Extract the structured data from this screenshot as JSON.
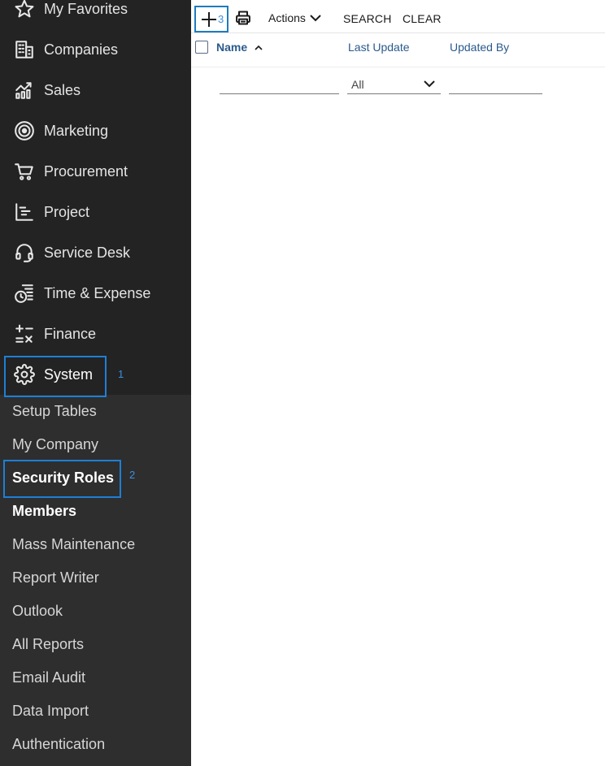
{
  "sidebar": {
    "items": [
      {
        "label": "My Favorites",
        "icon": "star-icon"
      },
      {
        "label": "Companies",
        "icon": "building-icon"
      },
      {
        "label": "Sales",
        "icon": "sales-chart-icon"
      },
      {
        "label": "Marketing",
        "icon": "target-icon"
      },
      {
        "label": "Procurement",
        "icon": "cart-icon"
      },
      {
        "label": "Project",
        "icon": "gantt-icon"
      },
      {
        "label": "Service Desk",
        "icon": "headset-icon"
      },
      {
        "label": "Time & Expense",
        "icon": "time-expense-icon"
      },
      {
        "label": "Finance",
        "icon": "finance-icon"
      },
      {
        "label": "System",
        "icon": "gear-icon"
      }
    ],
    "submenu": [
      "Setup Tables",
      "My Company",
      "Security Roles",
      "Members",
      "Mass Maintenance",
      "Report Writer",
      "Outlook",
      "All Reports",
      "Email Audit",
      "Data Import",
      "Authentication"
    ]
  },
  "callouts": {
    "system": "1",
    "security_roles": "2",
    "add": "3"
  },
  "toolbar": {
    "actions_label": "Actions",
    "search_label": "SEARCH",
    "clear_label": "CLEAR"
  },
  "table": {
    "columns": [
      "Name",
      "Last Update",
      "Updated By"
    ],
    "filters": {
      "last_update_value": "All"
    }
  },
  "colors": {
    "sidebar_bg": "#232323",
    "submenu_bg": "#2e2e2e",
    "callout_border": "#1e7fd6",
    "column_header": "#2a5a8c"
  }
}
